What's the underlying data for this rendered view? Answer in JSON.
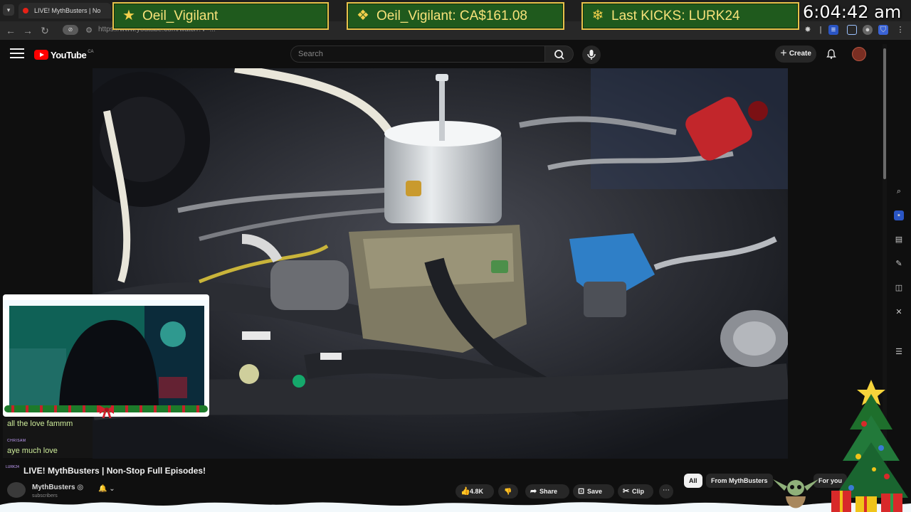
{
  "browser": {
    "tab_title": "LIVE! MythBusters | No",
    "url": "https://www.youtube.com/watch?v=..."
  },
  "overlay": {
    "banners": [
      {
        "icon": "star-icon",
        "text": "Oeil_Vigilant"
      },
      {
        "icon": "cash-icon",
        "text": "Oeil_Vigilant: CA$161.08"
      },
      {
        "icon": "snowflake-icon",
        "text": "Last KICKS: LURK24"
      }
    ],
    "clock": "6:04:42 am",
    "chat": [
      {
        "user": "",
        "message": "all the love fammm"
      },
      {
        "user": "CHRISAM",
        "message": "aye much love"
      }
    ],
    "title_prefix_user": "LURK24"
  },
  "youtube": {
    "logo_text": "YouTube",
    "region": "CA",
    "search_placeholder": "Search",
    "create_label": "Create"
  },
  "video": {
    "title": "LIVE! MythBusters | Non-Stop Full Episodes!",
    "channel": "MythBusters",
    "subscribers": "subscribers",
    "likes": "4.8K",
    "actions": [
      "Share",
      "Save",
      "Clip"
    ]
  },
  "chips": [
    "All",
    "From MythBusters",
    "For you"
  ],
  "colors": {
    "banner_green": "#1f5a1d",
    "banner_gold": "#e6c24a",
    "yt_red": "#ff0000"
  }
}
